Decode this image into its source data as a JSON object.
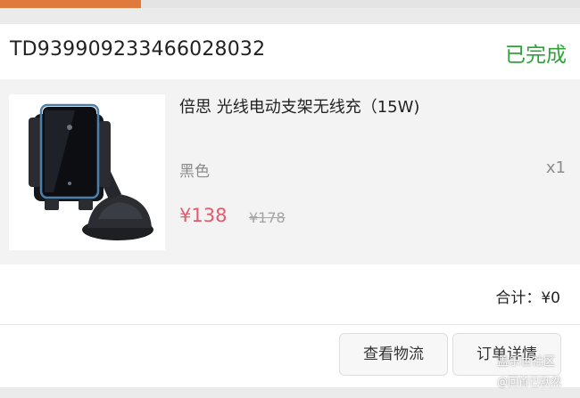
{
  "order": {
    "id": "TD939909233466028032",
    "status": "已完成",
    "status_color": "#2fa33a"
  },
  "top_progress": {
    "fraction": 0.243,
    "color": "#e07a3c"
  },
  "product": {
    "name": "倍思 光线电动支架无线充（15W)",
    "variant": "黑色",
    "quantity": "x1",
    "price": "¥138",
    "original_price": "¥178",
    "price_color": "#e45a6d"
  },
  "summary": {
    "total": "合计：¥0"
  },
  "actions": {
    "logistics_label": "查看物流",
    "detail_label": "订单详情"
  },
  "watermark": {
    "line1": "盖乐世社区",
    "line2": "@回首已默然"
  }
}
